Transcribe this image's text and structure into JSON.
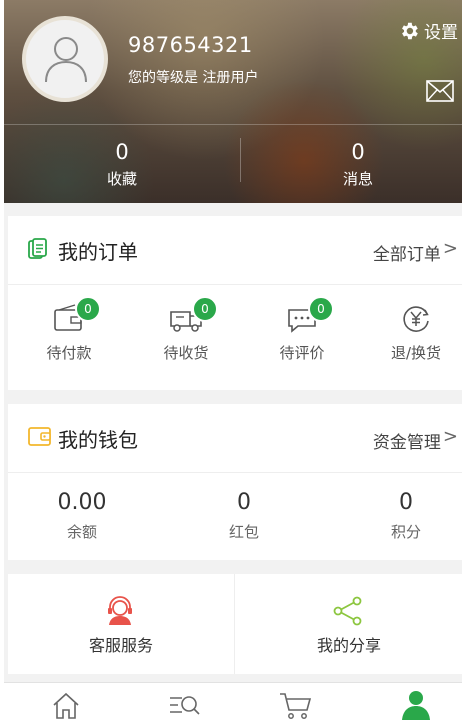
{
  "header": {
    "username": "987654321",
    "level_text": "您的等级是 注册用户",
    "settings_label": "设置",
    "stats": [
      {
        "value": "0",
        "label": "收藏"
      },
      {
        "value": "0",
        "label": "消息"
      }
    ]
  },
  "orders": {
    "title": "我的订单",
    "more_label": "全部订单",
    "chevron": ">",
    "items": [
      {
        "label": "待付款",
        "badge": "0",
        "icon": "wallet-icon"
      },
      {
        "label": "待收货",
        "badge": "0",
        "icon": "delivery-truck-icon"
      },
      {
        "label": "待评价",
        "badge": "0",
        "icon": "comment-icon"
      },
      {
        "label": "退/换货",
        "icon": "refund-yen-icon"
      }
    ]
  },
  "wallet": {
    "title": "我的钱包",
    "more_label": "资金管理",
    "chevron": ">",
    "items": [
      {
        "value": "0.00",
        "label": "余额"
      },
      {
        "value": "0",
        "label": "红包"
      },
      {
        "value": "0",
        "label": "积分"
      }
    ]
  },
  "services": [
    {
      "label": "客服服务",
      "icon": "headset-icon"
    },
    {
      "label": "我的分享",
      "icon": "share-icon"
    }
  ],
  "nav": [
    {
      "icon": "home-icon"
    },
    {
      "icon": "category-search-icon"
    },
    {
      "icon": "cart-icon"
    },
    {
      "icon": "user-icon",
      "active": true
    }
  ],
  "colors": {
    "accent_green": "#2aa84a",
    "service_red": "#e8534a",
    "wallet_yellow": "#f3b72d",
    "share_green": "#8cc63f"
  }
}
